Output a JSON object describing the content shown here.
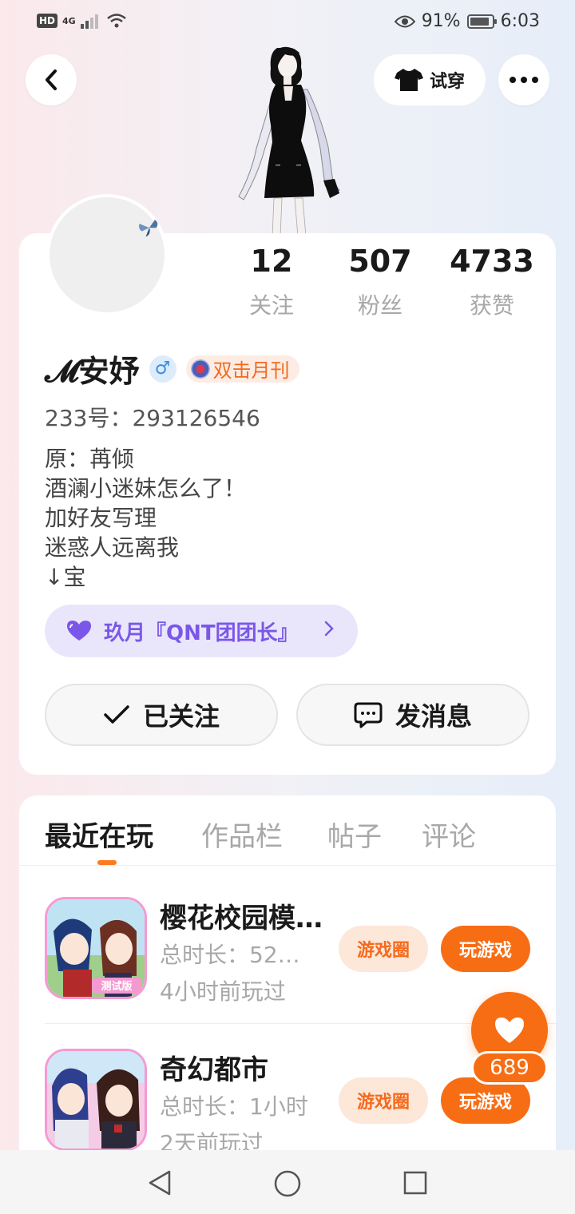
{
  "status_bar": {
    "hd": "HD",
    "network": "4G",
    "battery_pct": "91%",
    "battery_level": 0.91,
    "time": "6:03"
  },
  "header": {
    "tryon_label": "试穿"
  },
  "profile": {
    "stats": [
      {
        "value": "12",
        "label": "关注"
      },
      {
        "value": "507",
        "label": "粉丝"
      },
      {
        "value": "4733",
        "label": "获赞"
      }
    ],
    "nickname": "𝓜安妤",
    "gender_symbol": "♂",
    "medal_label": "双击月刊",
    "id_line": "233号：293126546",
    "bio_lines": [
      "原：苒倾",
      "酒澜小迷妹怎么了！",
      "加好友写理",
      "迷惑人远离我",
      "↓宝"
    ],
    "guild_label": "玖月『QNT团团长』",
    "followed_label": "已关注",
    "message_label": "发消息"
  },
  "tabs": [
    "最近在玩",
    "作品栏",
    "帖子",
    "评论"
  ],
  "games": [
    {
      "title": "樱花校园模…",
      "duration": "总时长：52…",
      "last_played": "4小时前玩过",
      "circle_label": "游戏圈",
      "play_label": "玩游戏"
    },
    {
      "title": "奇幻都市",
      "duration": "总时长：1小时",
      "last_played": "2天前玩过",
      "circle_label": "游戏圈",
      "play_label": "玩游戏"
    }
  ],
  "game_icon_badge": "测试版",
  "like_count": "689",
  "colors": {
    "accent": "#f76d14",
    "purple": "#7a57e8"
  }
}
